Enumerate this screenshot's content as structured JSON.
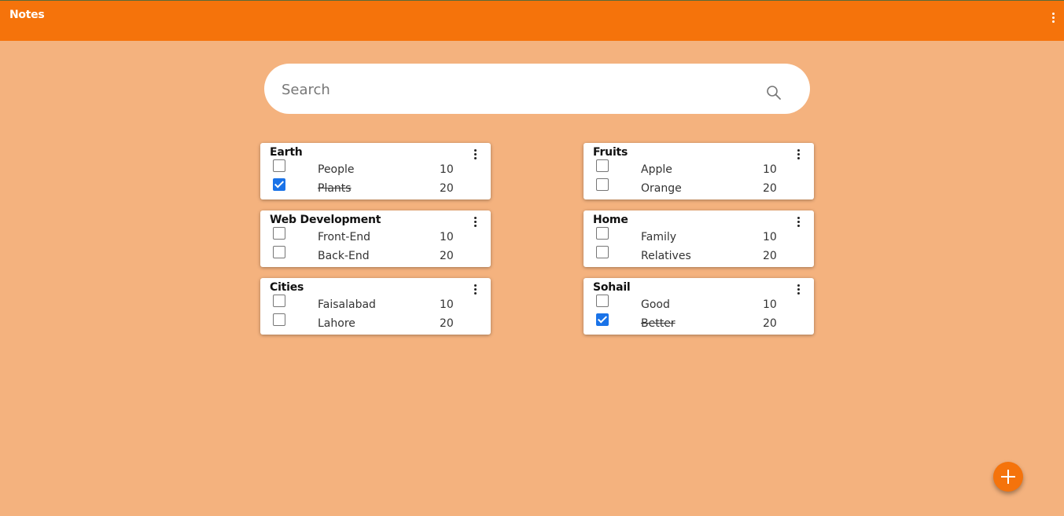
{
  "header": {
    "title": "Notes",
    "menu_icon": "more-vertical-icon"
  },
  "search": {
    "placeholder": "Search",
    "value": "",
    "icon": "search-icon"
  },
  "colors": {
    "accent": "#f5730b",
    "background": "#f4b27e",
    "checkbox_checked": "#1a73e8"
  },
  "notes": [
    {
      "title": "Earth",
      "items": [
        {
          "label": "People",
          "qty": "10",
          "checked": false
        },
        {
          "label": "Plants",
          "qty": "20",
          "checked": true
        }
      ]
    },
    {
      "title": "Fruits",
      "items": [
        {
          "label": "Apple",
          "qty": "10",
          "checked": false
        },
        {
          "label": "Orange",
          "qty": "20",
          "checked": false
        }
      ]
    },
    {
      "title": "Web Development",
      "items": [
        {
          "label": "Front-End",
          "qty": "10",
          "checked": false
        },
        {
          "label": "Back-End",
          "qty": "20",
          "checked": false
        }
      ]
    },
    {
      "title": "Home",
      "items": [
        {
          "label": "Family",
          "qty": "10",
          "checked": false
        },
        {
          "label": "Relatives",
          "qty": "20",
          "checked": false
        }
      ]
    },
    {
      "title": "Cities",
      "items": [
        {
          "label": "Faisalabad",
          "qty": "10",
          "checked": false
        },
        {
          "label": "Lahore",
          "qty": "20",
          "checked": false
        }
      ]
    },
    {
      "title": "Sohail",
      "items": [
        {
          "label": "Good",
          "qty": "10",
          "checked": false
        },
        {
          "label": "Better",
          "qty": "20",
          "checked": true
        }
      ]
    }
  ],
  "fab": {
    "icon": "plus-icon"
  }
}
